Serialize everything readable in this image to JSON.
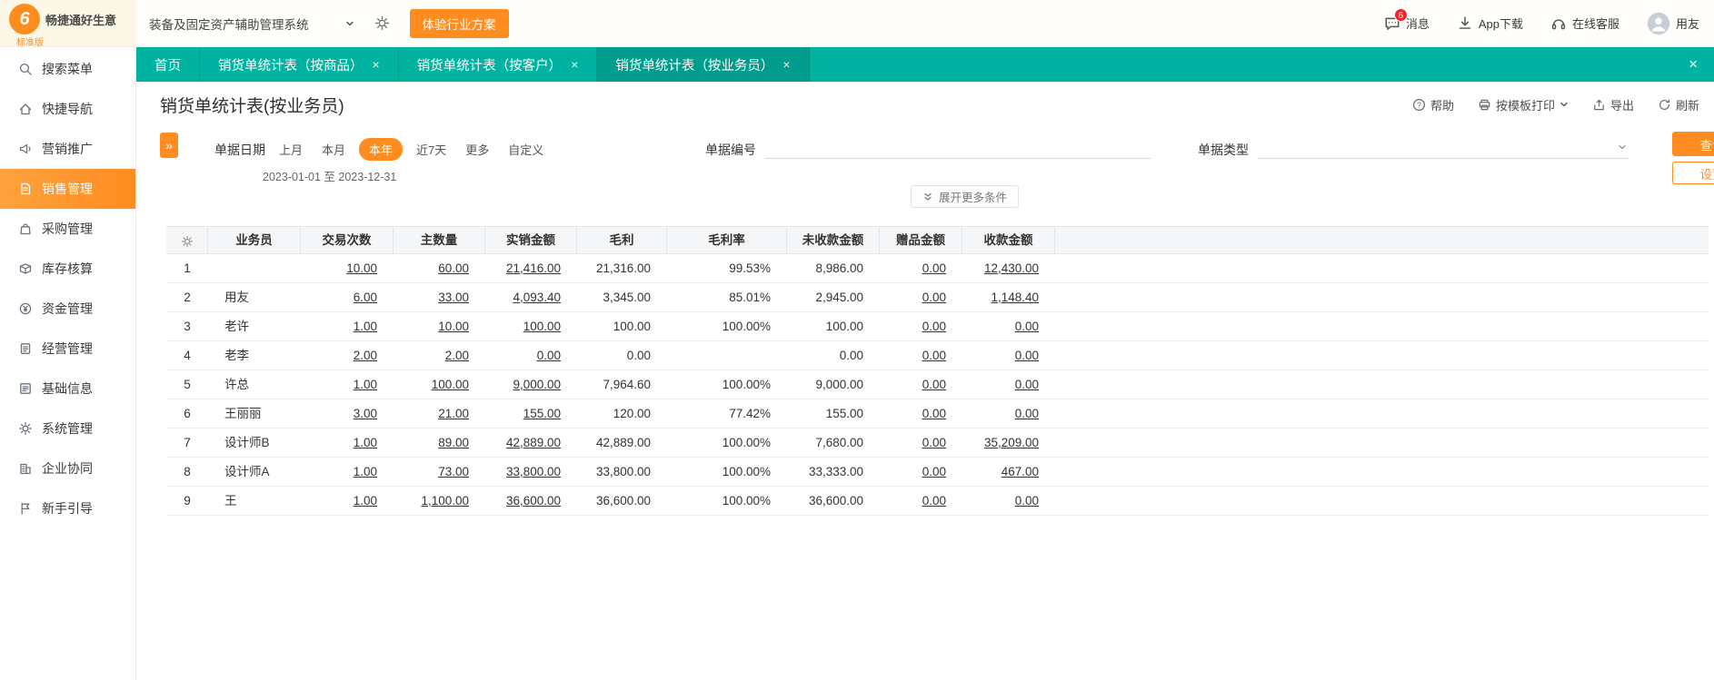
{
  "topbar": {
    "brand": {
      "logo_glyph": "6",
      "name": "畅捷通好生意",
      "edition": "标准版"
    },
    "system_select": "装备及固定资产辅助管理系统",
    "industry_button": "体验行业方案",
    "message": {
      "label": "消息",
      "badge": "6"
    },
    "app_download": "App下载",
    "online_service": "在线客服",
    "user": "用友"
  },
  "sidebar": {
    "items": [
      {
        "label": "搜索菜单"
      },
      {
        "label": "快捷导航"
      },
      {
        "label": "营销推广"
      },
      {
        "label": "销售管理",
        "active": true
      },
      {
        "label": "采购管理"
      },
      {
        "label": "库存核算"
      },
      {
        "label": "资金管理"
      },
      {
        "label": "经营管理"
      },
      {
        "label": "基础信息"
      },
      {
        "label": "系统管理"
      },
      {
        "label": "企业协同"
      },
      {
        "label": "新手引导"
      }
    ]
  },
  "tabs": [
    {
      "label": "首页",
      "closable": false,
      "active": false
    },
    {
      "label": "销货单统计表（按商品）",
      "closable": true,
      "active": false
    },
    {
      "label": "销货单统计表（按客户）",
      "closable": true,
      "active": false
    },
    {
      "label": "销货单统计表（按业务员）",
      "closable": true,
      "active": true
    }
  ],
  "page": {
    "title": "销货单统计表(按业务员)",
    "toolbar": {
      "help": "帮助",
      "print": "按模板打印",
      "export": "导出",
      "refresh": "刷新"
    }
  },
  "filters": {
    "date_label": "单据日期",
    "date_options": [
      "上月",
      "本月",
      "本年",
      "近7天",
      "更多",
      "自定义"
    ],
    "date_selected": "本年",
    "date_range": "2023-01-01 至 2023-12-31",
    "doc_no_label": "单据编号",
    "doc_type_label": "单据类型",
    "search_button": "查询",
    "settings_button": "设置",
    "expand_more": "展开更多条件"
  },
  "table": {
    "columns": [
      "业务员",
      "交易次数",
      "主数量",
      "实销金额",
      "毛利",
      "毛利率",
      "未收款金额",
      "赠品金额",
      "收款金额"
    ],
    "rows": [
      {
        "num": "1",
        "name": "",
        "trades": "10.00",
        "qty": "60.00",
        "amount": "21,416.00",
        "profit": "21,316.00",
        "margin": "99.53%",
        "unpaid": "8,986.00",
        "gift": "0.00",
        "received": "12,430.00"
      },
      {
        "num": "2",
        "name": "用友",
        "trades": "6.00",
        "qty": "33.00",
        "amount": "4,093.40",
        "profit": "3,345.00",
        "margin": "85.01%",
        "unpaid": "2,945.00",
        "gift": "0.00",
        "received": "1,148.40"
      },
      {
        "num": "3",
        "name": "老许",
        "trades": "1.00",
        "qty": "10.00",
        "amount": "100.00",
        "profit": "100.00",
        "margin": "100.00%",
        "unpaid": "100.00",
        "gift": "0.00",
        "received": "0.00"
      },
      {
        "num": "4",
        "name": "老李",
        "trades": "2.00",
        "qty": "2.00",
        "amount": "0.00",
        "profit": "0.00",
        "margin": "",
        "unpaid": "0.00",
        "gift": "0.00",
        "received": "0.00"
      },
      {
        "num": "5",
        "name": "许总",
        "trades": "1.00",
        "qty": "100.00",
        "amount": "9,000.00",
        "profit": "7,964.60",
        "margin": "100.00%",
        "unpaid": "9,000.00",
        "gift": "0.00",
        "received": "0.00"
      },
      {
        "num": "6",
        "name": "王丽丽",
        "trades": "3.00",
        "qty": "21.00",
        "amount": "155.00",
        "profit": "120.00",
        "margin": "77.42%",
        "unpaid": "155.00",
        "gift": "0.00",
        "received": "0.00"
      },
      {
        "num": "7",
        "name": "设计师B",
        "trades": "1.00",
        "qty": "89.00",
        "amount": "42,889.00",
        "profit": "42,889.00",
        "margin": "100.00%",
        "unpaid": "7,680.00",
        "gift": "0.00",
        "received": "35,209.00"
      },
      {
        "num": "8",
        "name": "设计师A",
        "trades": "1.00",
        "qty": "73.00",
        "amount": "33,800.00",
        "profit": "33,800.00",
        "margin": "100.00%",
        "unpaid": "33,333.00",
        "gift": "0.00",
        "received": "467.00"
      },
      {
        "num": "9",
        "name": "王",
        "trades": "1.00",
        "qty": "1,100.00",
        "amount": "36,600.00",
        "profit": "36,600.00",
        "margin": "100.00%",
        "unpaid": "36,600.00",
        "gift": "0.00",
        "received": "0.00"
      }
    ]
  }
}
